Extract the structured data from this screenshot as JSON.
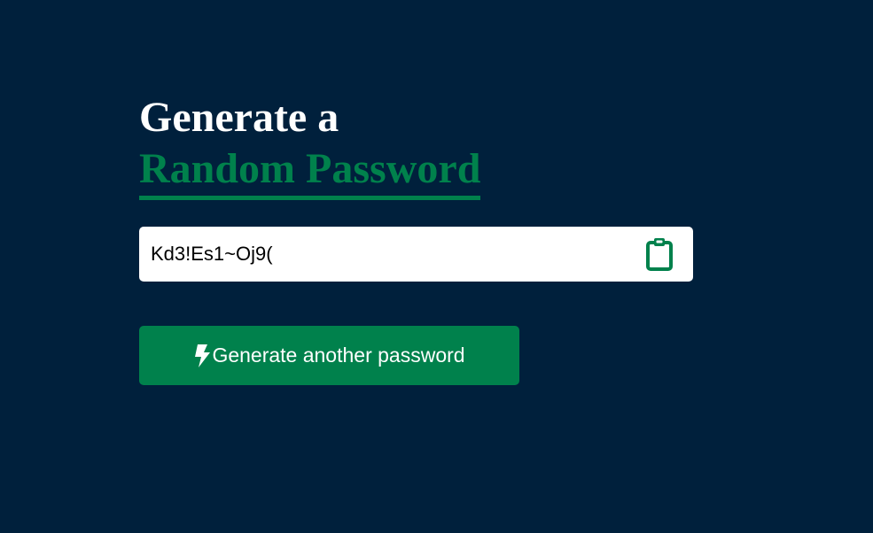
{
  "header": {
    "line1": "Generate a",
    "line2": "Random Password"
  },
  "password": {
    "value": "Kd3!Es1~Oj9("
  },
  "actions": {
    "copy_icon": "clipboard-icon",
    "generate_icon": "bolt-icon",
    "generate_label": "Generate another password"
  },
  "colors": {
    "background": "#00203c",
    "accent": "#00814c",
    "text": "#ffffff"
  }
}
